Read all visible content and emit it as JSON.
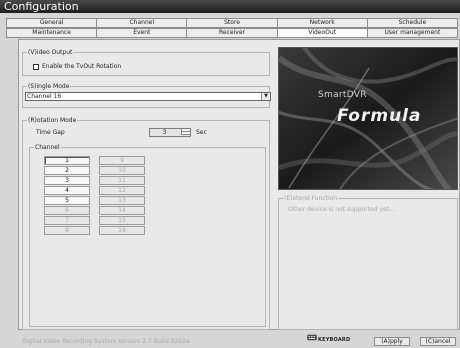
{
  "window": {
    "title": "Configuration"
  },
  "tabs": {
    "row1": [
      "General",
      "Channel",
      "Store",
      "Network",
      "Schedule"
    ],
    "row2": [
      "Maintenance",
      "Event",
      "Receiver",
      "VideoOut",
      "User management"
    ],
    "active": "VideoOut"
  },
  "video_output": {
    "legend": "(V)ideo Output",
    "checkbox_label": "Enable the TvOut Rotation",
    "checked": false
  },
  "single_mode": {
    "legend": "(S)ingle Mode",
    "selected": "Channel 16"
  },
  "rotation_mode": {
    "legend": "(R)otation Mode",
    "time_gap_label": "Time Gap",
    "time_gap_value": "3",
    "unit": "Sec",
    "channel_legend": "Channel",
    "channels_left": [
      "1",
      "2",
      "3",
      "4",
      "5",
      "6",
      "7",
      "8"
    ],
    "channels_right": [
      "9",
      "10",
      "11",
      "12",
      "13",
      "14",
      "15",
      "16"
    ],
    "left_enabled_count": 5,
    "selected_channel": "1"
  },
  "logo": {
    "brand": "SmartDVR",
    "product": "Formula"
  },
  "extend_function": {
    "legend": "(E)xtend Function",
    "message": "Other device is not supported yet..."
  },
  "footer": {
    "version": "Digital Video Recording System Version 2.7 Build 0202a",
    "keyboard_label": "KEYBOARD",
    "apply_label": "(A)pply",
    "cancel_label": "(C)ancel"
  },
  "colors": {
    "title_bar": "#2a2a2a",
    "panel": "#e9e9e9",
    "disabled_text": "#aaaaaa"
  },
  "icons": [
    "keyboard-icon",
    "dropdown-arrow-icon",
    "spin-up-icon",
    "spin-down-icon"
  ]
}
